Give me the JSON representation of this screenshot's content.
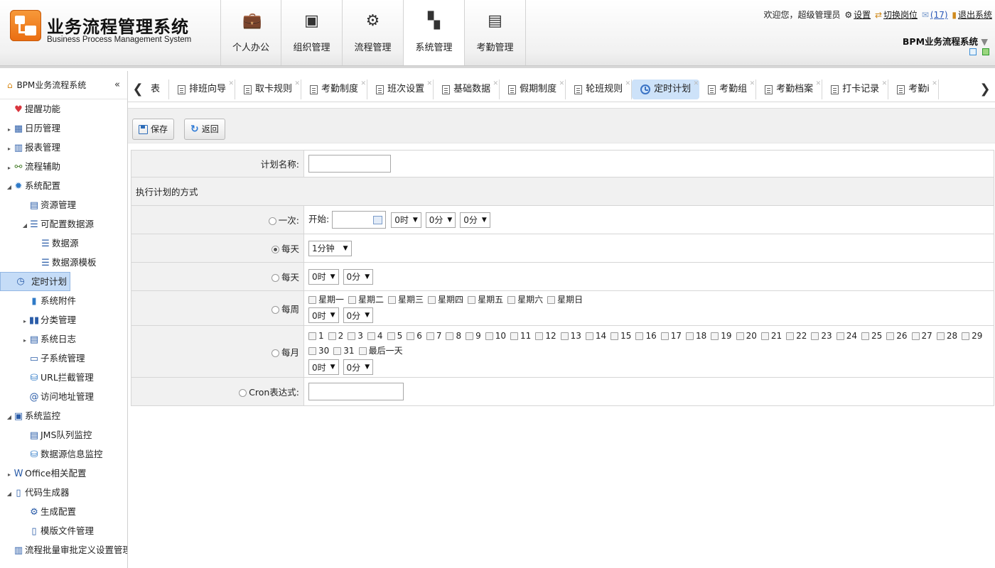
{
  "header": {
    "title": "业务流程管理系统",
    "subtitle": "Business Process Management System",
    "nav": [
      {
        "label": "个人办公",
        "icon": "briefcase-icon",
        "glyph": "💼"
      },
      {
        "label": "组织管理",
        "icon": "org-icon",
        "glyph": "▣"
      },
      {
        "label": "流程管理",
        "icon": "gears-icon",
        "glyph": "⚙"
      },
      {
        "label": "系统管理",
        "icon": "dashboard-icon",
        "glyph": "▚"
      },
      {
        "label": "考勤管理",
        "icon": "document-icon",
        "glyph": "▤"
      }
    ],
    "active_nav": "系统管理",
    "welcome_text": "欢迎您，超级管理员",
    "settings_link": "设置",
    "switch_post_link": "切换岗位",
    "mail_count": "(17)",
    "logout_link": "退出系统",
    "system_switch": "BPM业务流程系统"
  },
  "sidebar": {
    "title": "BPM业务流程系统",
    "collapse_glyph": "«",
    "items": [
      {
        "label": "提醒功能",
        "level": 0,
        "toggle": "",
        "glyph": "♥",
        "color": "#d9363e",
        "name": "sidebar-item-reminder"
      },
      {
        "label": "日历管理",
        "level": 0,
        "toggle": "▸",
        "glyph": "▦",
        "color": "#2a5ca8",
        "name": "sidebar-item-calendar"
      },
      {
        "label": "报表管理",
        "level": 0,
        "toggle": "▸",
        "glyph": "▥",
        "color": "#2a5ca8",
        "name": "sidebar-item-reports"
      },
      {
        "label": "流程辅助",
        "level": 0,
        "toggle": "▸",
        "glyph": "⚯",
        "color": "#4a7f2f",
        "name": "sidebar-item-process-aid"
      },
      {
        "label": "系统配置",
        "level": 0,
        "toggle": "◢",
        "glyph": "✹",
        "color": "#2f7ac7",
        "name": "sidebar-item-system-config"
      },
      {
        "label": "资源管理",
        "level": 1,
        "toggle": "",
        "glyph": "▤",
        "color": "#2a5ca8",
        "name": "sidebar-item-resources"
      },
      {
        "label": "可配置数据源",
        "level": 1,
        "toggle": "◢",
        "glyph": "☰",
        "color": "#2a5ca8",
        "name": "sidebar-item-configurable-datasource"
      },
      {
        "label": "数据源",
        "level": 2,
        "toggle": "",
        "glyph": "☰",
        "color": "#2a5ca8",
        "name": "sidebar-item-datasource"
      },
      {
        "label": "数据源模板",
        "level": 2,
        "toggle": "",
        "glyph": "☰",
        "color": "#2a5ca8",
        "name": "sidebar-item-datasource-template"
      },
      {
        "label": "定时计划",
        "level": 1,
        "toggle": "",
        "glyph": "◷",
        "color": "#2a5ca8",
        "name": "sidebar-item-scheduled-plan",
        "selected": true
      },
      {
        "label": "系统附件",
        "level": 1,
        "toggle": "",
        "glyph": "▮",
        "color": "#2f7ac7",
        "name": "sidebar-item-attachments"
      },
      {
        "label": "分类管理",
        "level": 1,
        "toggle": "▸",
        "glyph": "▮▮",
        "color": "#2a5ca8",
        "name": "sidebar-item-categories"
      },
      {
        "label": "系统日志",
        "level": 1,
        "toggle": "▸",
        "glyph": "▤",
        "color": "#2a5ca8",
        "name": "sidebar-item-system-log"
      },
      {
        "label": "子系统管理",
        "level": 1,
        "toggle": "",
        "glyph": "▭",
        "color": "#2a5ca8",
        "name": "sidebar-item-subsystems"
      },
      {
        "label": "URL拦截管理",
        "level": 1,
        "toggle": "",
        "glyph": "⛁",
        "color": "#2f7ac7",
        "name": "sidebar-item-url-intercept"
      },
      {
        "label": "访问地址管理",
        "level": 1,
        "toggle": "",
        "glyph": "@",
        "color": "#2a5ca8",
        "name": "sidebar-item-access-address"
      },
      {
        "label": "系统监控",
        "level": 0,
        "toggle": "◢",
        "glyph": "▣",
        "color": "#2a5ca8",
        "name": "sidebar-item-system-monitor"
      },
      {
        "label": "JMS队列监控",
        "level": 1,
        "toggle": "",
        "glyph": "▤",
        "color": "#2a5ca8",
        "name": "sidebar-item-jms-monitor"
      },
      {
        "label": "数据源信息监控",
        "level": 1,
        "toggle": "",
        "glyph": "⛁",
        "color": "#2f7ac7",
        "name": "sidebar-item-datasource-monitor"
      },
      {
        "label": "Office相关配置",
        "level": 0,
        "toggle": "▸",
        "glyph": "W",
        "color": "#2a5ca8",
        "name": "sidebar-item-office-config"
      },
      {
        "label": "代码生成器",
        "level": 0,
        "toggle": "◢",
        "glyph": "▯",
        "color": "#2a5ca8",
        "name": "sidebar-item-code-generator"
      },
      {
        "label": "生成配置",
        "level": 1,
        "toggle": "",
        "glyph": "⚙",
        "color": "#2a5ca8",
        "name": "sidebar-item-generate-config"
      },
      {
        "label": "模版文件管理",
        "level": 1,
        "toggle": "",
        "glyph": "▯",
        "color": "#2a5ca8",
        "name": "sidebar-item-template-files"
      },
      {
        "label": "流程批量审批定义设置管理",
        "level": 0,
        "toggle": "",
        "glyph": "▥",
        "color": "#2a5ca8",
        "name": "sidebar-item-batch-approval"
      }
    ]
  },
  "tabs": [
    {
      "label": "表",
      "name": "tab-table",
      "doc": false
    },
    {
      "label": "排班向导",
      "name": "tab-shift-wizard",
      "doc": true
    },
    {
      "label": "取卡规则",
      "name": "tab-card-rules",
      "doc": true
    },
    {
      "label": "考勤制度",
      "name": "tab-attendance-policy",
      "doc": true
    },
    {
      "label": "班次设置",
      "name": "tab-shift-settings",
      "doc": true
    },
    {
      "label": "基础数据",
      "name": "tab-basic-data",
      "doc": true
    },
    {
      "label": "假期制度",
      "name": "tab-holiday-policy",
      "doc": true
    },
    {
      "label": "轮班规则",
      "name": "tab-rotation-rules",
      "doc": true
    },
    {
      "label": "定时计划",
      "name": "tab-scheduled-plan",
      "doc": false,
      "active": true
    },
    {
      "label": "考勤组",
      "name": "tab-attendance-group",
      "doc": true
    },
    {
      "label": "考勤档案",
      "name": "tab-attendance-archive",
      "doc": true
    },
    {
      "label": "打卡记录",
      "name": "tab-punch-records",
      "doc": true
    },
    {
      "label": "考勤i",
      "name": "tab-attendance-more",
      "doc": true
    }
  ],
  "toolbar": {
    "save_label": "保存",
    "back_label": "返回"
  },
  "form": {
    "plan_name_label": "计划名称:",
    "plan_name_value": "",
    "section_title": "执行计划的方式",
    "once_label": "一次:",
    "start_label": "开始:",
    "once_hour": "0时",
    "once_minute": "0分",
    "once_second": "0分",
    "daily_interval_label": "每天",
    "daily_interval_value": "1分钟",
    "daily_time_label": "每天",
    "daily_hour": "0时",
    "daily_minute": "0分",
    "weekly_label": "每周",
    "weekdays": [
      "星期一",
      "星期二",
      "星期三",
      "星期四",
      "星期五",
      "星期六",
      "星期日"
    ],
    "weekly_hour": "0时",
    "weekly_minute": "0分",
    "monthly_label": "每月",
    "month_days": [
      "1",
      "2",
      "3",
      "4",
      "5",
      "6",
      "7",
      "8",
      "9",
      "10",
      "11",
      "12",
      "13",
      "14",
      "15",
      "16",
      "17",
      "18",
      "19",
      "20",
      "21",
      "22",
      "23",
      "24",
      "25",
      "26",
      "27",
      "28",
      "29",
      "30",
      "31",
      "最后一天"
    ],
    "monthly_hour": "0时",
    "monthly_minute": "0分",
    "cron_label": "Cron表达式:",
    "cron_value": ""
  }
}
